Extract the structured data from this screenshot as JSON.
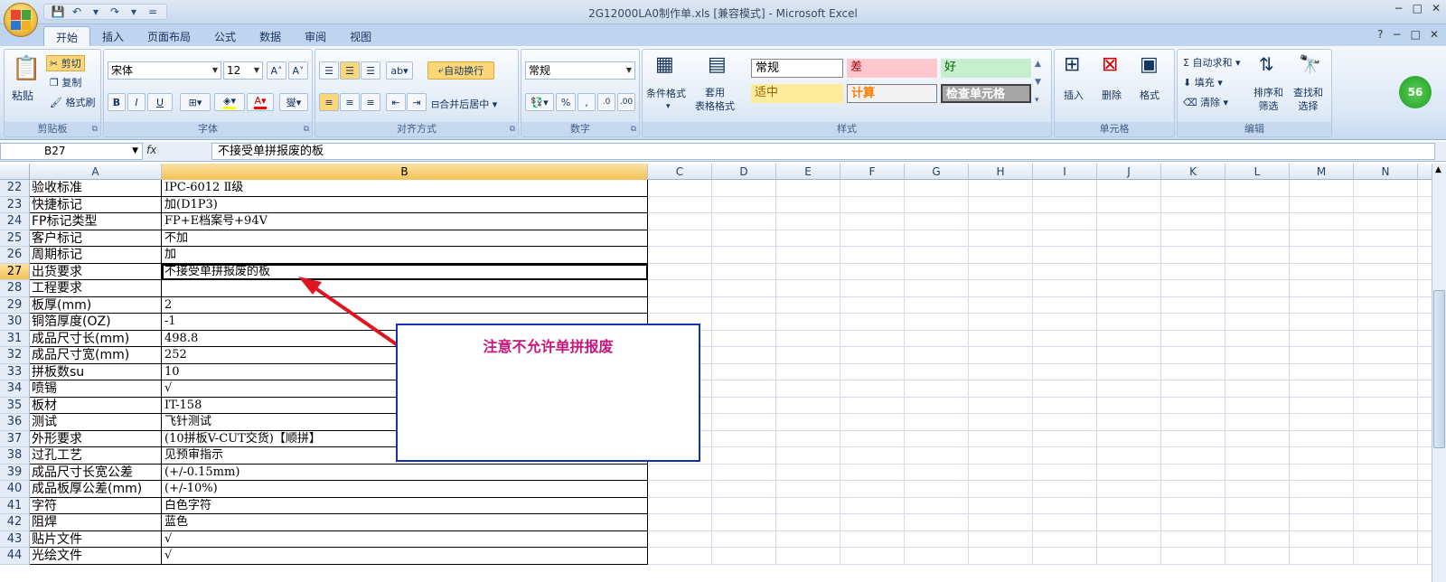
{
  "window": {
    "title": "2G12000LA0制作单.xls  [兼容模式] - Microsoft Excel",
    "controls": [
      "−",
      "□",
      "✕"
    ],
    "ribbon_controls": [
      "?",
      "−",
      "□",
      "✕"
    ]
  },
  "qat": [
    "💾",
    "↶",
    "▾",
    "↷",
    "▾",
    "="
  ],
  "tabs": [
    "开始",
    "插入",
    "页面布局",
    "公式",
    "数据",
    "审阅",
    "视图"
  ],
  "ribbon": {
    "clipboard": {
      "label": "剪贴板",
      "paste": "粘贴",
      "cut": "剪切",
      "copy": "复制",
      "format_painter": "格式刷"
    },
    "font": {
      "label": "字体",
      "font_name": "宋体",
      "font_size": "12",
      "bold": "B",
      "italic": "I",
      "underline": "U"
    },
    "alignment": {
      "label": "对齐方式",
      "wrap": "自动换行",
      "merge": "合并后居中"
    },
    "number": {
      "label": "数字",
      "format": "常规",
      "percent": "%",
      "comma": ","
    },
    "styles": {
      "label": "样式",
      "cond_format": "条件格式",
      "table_format": "套用\n表格格式",
      "cells": [
        {
          "text": "常规",
          "bg": "#ffffff",
          "fg": "#000000"
        },
        {
          "text": "差",
          "bg": "#ffc7ce",
          "fg": "#9c0006"
        },
        {
          "text": "好",
          "bg": "#c6efce",
          "fg": "#006100"
        },
        {
          "text": "适中",
          "bg": "#ffeb9c",
          "fg": "#9c6500"
        },
        {
          "text": "计算",
          "bg": "#f2f2f2",
          "fg": "#fa7d00"
        },
        {
          "text": "检查单元格",
          "bg": "#a5a5a5",
          "fg": "#ffffff"
        }
      ]
    },
    "cells": {
      "label": "单元格",
      "insert": "插入",
      "delete": "删除",
      "format": "格式"
    },
    "editing": {
      "label": "编辑",
      "autosum": "自动求和",
      "fill": "填充",
      "clear": "清除",
      "sort": "排序和\n筛选",
      "find": "查找和\n选择"
    }
  },
  "formula_bar": {
    "name_box": "B27",
    "fx": "fx",
    "formula": "不接受单拼报废的板"
  },
  "columns": [
    "A",
    "B",
    "C",
    "D",
    "E",
    "F",
    "G",
    "H",
    "I",
    "J",
    "K",
    "L",
    "M",
    "N"
  ],
  "rows": [
    {
      "n": "22",
      "a": "验收标准",
      "b": "IPC-6012 Ⅱ级"
    },
    {
      "n": "23",
      "a": "快捷标记",
      "b": "加(D1P3)"
    },
    {
      "n": "24",
      "a": "FP标记类型",
      "b": "FP+E档案号+94V"
    },
    {
      "n": "25",
      "a": "客户标记",
      "b": "不加"
    },
    {
      "n": "26",
      "a": "周期标记",
      "b": "加"
    },
    {
      "n": "27",
      "a": "出货要求",
      "b": "不接受单拼报废的板"
    },
    {
      "n": "28",
      "a": "工程要求",
      "b": ""
    },
    {
      "n": "29",
      "a": "板厚(mm)",
      "b": "2"
    },
    {
      "n": "30",
      "a": "铜箔厚度(OZ)",
      "b": "-1"
    },
    {
      "n": "31",
      "a": "成品尺寸长(mm)",
      "b": "498.8"
    },
    {
      "n": "32",
      "a": "成品尺寸宽(mm)",
      "b": "252"
    },
    {
      "n": "33",
      "a": "拼板数su",
      "b": "10"
    },
    {
      "n": "34",
      "a": "喷锡",
      "b": "√"
    },
    {
      "n": "35",
      "a": "板材",
      "b": "IT-158"
    },
    {
      "n": "36",
      "a": "测试",
      "b": "飞针测试"
    },
    {
      "n": "37",
      "a": "外形要求",
      "b": "(10拼板V-CUT交货)【顺拼】"
    },
    {
      "n": "38",
      "a": "过孔工艺",
      "b": "见预审指示"
    },
    {
      "n": "39",
      "a": "成品尺寸长宽公差",
      "b": "(+/-0.15mm)"
    },
    {
      "n": "40",
      "a": "成品板厚公差(mm)",
      "b": "(+/-10%)"
    },
    {
      "n": "41",
      "a": "字符",
      "b": "白色字符"
    },
    {
      "n": "42",
      "a": "阻焊",
      "b": "蓝色"
    },
    {
      "n": "43",
      "a": "贴片文件",
      "b": "√"
    },
    {
      "n": "44",
      "a": "光绘文件",
      "b": "√"
    }
  ],
  "selected_row": "27",
  "callout": {
    "text": "注意不允许单拼报废",
    "border_color": "#1530b0",
    "text_color": "#c8177a"
  },
  "arrow_color": "#e0141e",
  "badge": "56"
}
